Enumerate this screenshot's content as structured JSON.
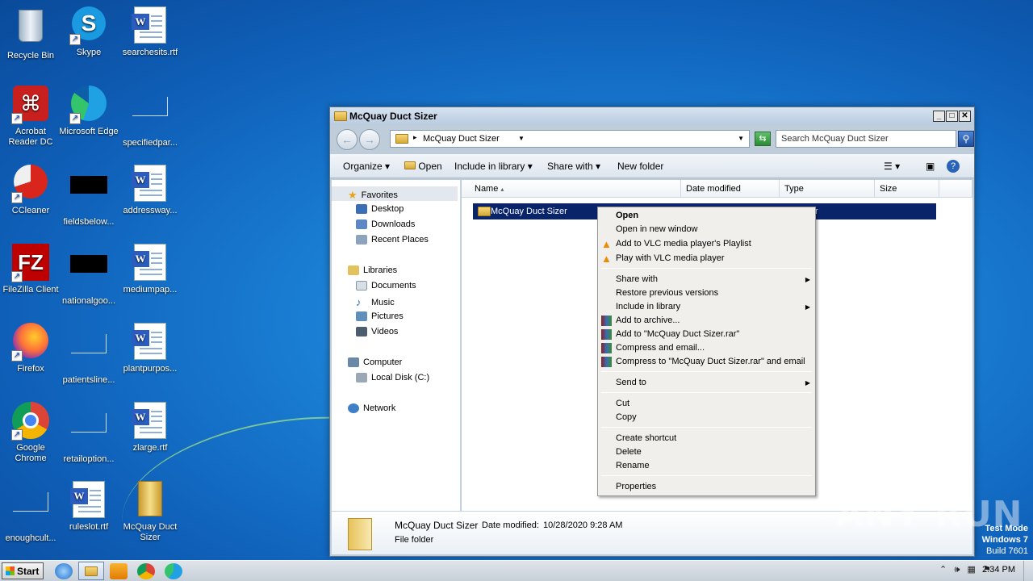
{
  "desktop_icons": [
    {
      "label": "Recycle Bin"
    },
    {
      "label": "Skype"
    },
    {
      "label": "searchesits.rtf"
    },
    {
      "label": "Acrobat Reader DC"
    },
    {
      "label": "Microsoft Edge"
    },
    {
      "label": "specifiedpar..."
    },
    {
      "label": "CCleaner"
    },
    {
      "label": "fieldsbelow..."
    },
    {
      "label": "addressway..."
    },
    {
      "label": "FileZilla Client"
    },
    {
      "label": "nationalgoo..."
    },
    {
      "label": "mediumpap..."
    },
    {
      "label": "Firefox"
    },
    {
      "label": "patientsline..."
    },
    {
      "label": "plantpurpos..."
    },
    {
      "label": "Google Chrome"
    },
    {
      "label": "retailoption..."
    },
    {
      "label": "zlarge.rtf"
    },
    {
      "label": "enoughcult..."
    },
    {
      "label": "ruleslot.rtf"
    },
    {
      "label": "McQuay Duct Sizer"
    }
  ],
  "window": {
    "title": "McQuay Duct Sizer",
    "address_crumb": "McQuay Duct Sizer",
    "search_placeholder": "Search McQuay Duct Sizer",
    "toolbar": {
      "organize": "Organize",
      "open": "Open",
      "include_in_library": "Include in library",
      "share_with": "Share with",
      "new_folder": "New folder"
    },
    "nav": {
      "favorites": "Favorites",
      "desktop": "Desktop",
      "downloads": "Downloads",
      "recent_places": "Recent Places",
      "libraries": "Libraries",
      "documents": "Documents",
      "music": "Music",
      "pictures": "Pictures",
      "videos": "Videos",
      "computer": "Computer",
      "local_disk": "Local Disk (C:)",
      "network": "Network"
    },
    "columns": {
      "name": "Name",
      "date_modified": "Date modified",
      "type": "Type",
      "size": "Size"
    },
    "selected_item": {
      "name": "McQuay Duct Sizer",
      "type_fragment": "r"
    },
    "details": {
      "name": "McQuay Duct Sizer",
      "date_label": "Date modified:",
      "date_value": "10/28/2020 9:28 AM",
      "type": "File folder"
    }
  },
  "context_menu": {
    "open": "Open",
    "open_new_window": "Open in new window",
    "vlc_playlist": "Add to VLC media player's Playlist",
    "vlc_play": "Play with VLC media player",
    "share_with": "Share with",
    "restore_previous": "Restore previous versions",
    "include_in_library": "Include in library",
    "add_to_archive": "Add to archive...",
    "add_to_rar": "Add to \"McQuay Duct Sizer.rar\"",
    "compress_email": "Compress and email...",
    "compress_rar_email": "Compress to \"McQuay Duct Sizer.rar\" and email",
    "send_to": "Send to",
    "cut": "Cut",
    "copy": "Copy",
    "create_shortcut": "Create shortcut",
    "delete": "Delete",
    "rename": "Rename",
    "properties": "Properties"
  },
  "taskbar": {
    "start": "Start",
    "time": "2:34 PM"
  },
  "watermark": {
    "line1": "Test Mode",
    "line2": "Windows 7",
    "line3": "Build 7601",
    "brand": "ANY RUN"
  }
}
